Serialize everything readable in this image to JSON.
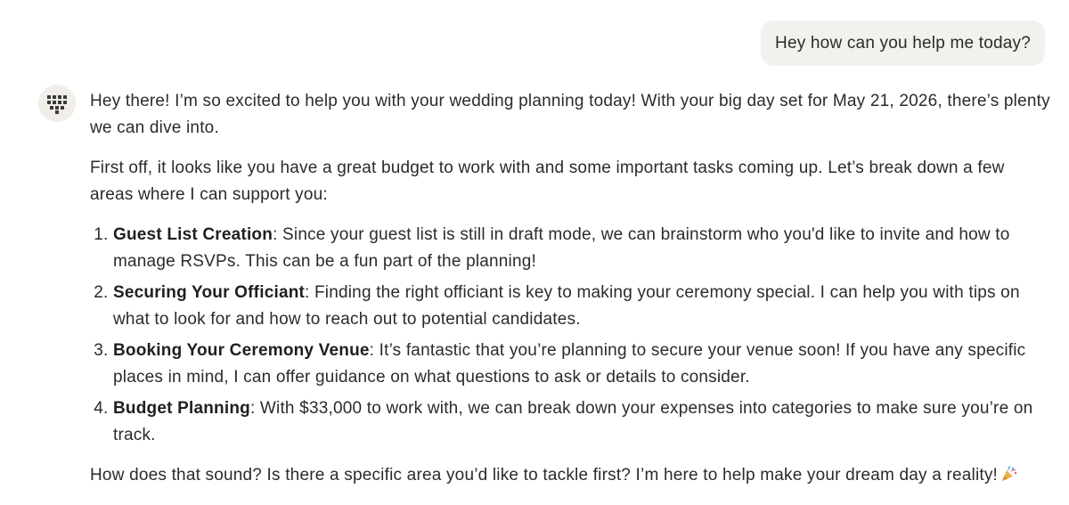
{
  "user_message": "Hey how can you help me today?",
  "assistant": {
    "avatar_icon": "heart-grid-icon",
    "paragraph_1": "Hey there! I’m so excited to help you with your wedding planning today! With your big day set for May 21, 2026, there’s plenty we can dive into.",
    "paragraph_2": "First off, it looks like you have a great budget to work with and some important tasks coming up. Let’s break down a few areas where I can support you:",
    "list": [
      {
        "title": "Guest List Creation",
        "text": ": Since your guest list is still in draft mode, we can brainstorm who you'd like to invite and how to manage RSVPs. This can be a fun part of the planning!"
      },
      {
        "title": "Securing Your Officiant",
        "text": ": Finding the right officiant is key to making your ceremony special. I can help you with tips on what to look for and how to reach out to potential candidates."
      },
      {
        "title": "Booking Your Ceremony Venue",
        "text": ": It’s fantastic that you’re planning to secure your venue soon! If you have any specific places in mind, I can offer guidance on what questions to ask or details to consider."
      },
      {
        "title": "Budget Planning",
        "text": ": With $33,000 to work with, we can break down your expenses into categories to make sure you’re on track."
      }
    ],
    "closing": "How does that sound? Is there a specific area you’d like to tackle first? I’m here to help make your dream day a reality!",
    "closing_emoji": "party-popper-icon"
  }
}
